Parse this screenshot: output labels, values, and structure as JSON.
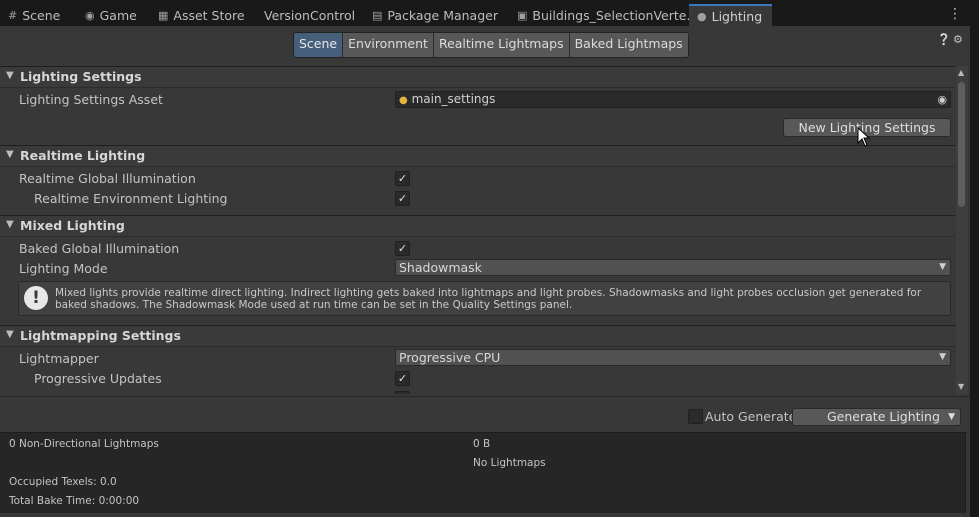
{
  "tabs": [
    {
      "label": "Scene",
      "icon": "grid-icon"
    },
    {
      "label": "Game",
      "icon": "gamepad-icon"
    },
    {
      "label": "Asset Store",
      "icon": "store-icon"
    },
    {
      "label": "VersionControl",
      "icon": ""
    },
    {
      "label": "Package Manager",
      "icon": "package-icon"
    },
    {
      "label": "Buildings_SelectionVerte...",
      "icon": "shader-icon"
    },
    {
      "label": "Lighting",
      "icon": "bulb-icon"
    }
  ],
  "subtabs": [
    "Scene",
    "Environment",
    "Realtime Lightmaps",
    "Baked Lightmaps"
  ],
  "lighting_settings": {
    "header": "Lighting Settings",
    "asset_label": "Lighting Settings Asset",
    "asset_value": "main_settings",
    "new_button": "New Lighting Settings"
  },
  "realtime_lighting": {
    "header": "Realtime Lighting",
    "gi_label": "Realtime Global Illumination",
    "gi_checked": true,
    "env_label": "Realtime Environment Lighting",
    "env_checked": true
  },
  "mixed_lighting": {
    "header": "Mixed Lighting",
    "baked_gi_label": "Baked Global Illumination",
    "baked_gi_checked": true,
    "mode_label": "Lighting Mode",
    "mode_value": "Shadowmask",
    "help_text": "Mixed lights provide realtime direct lighting. Indirect lighting gets baked into lightmaps and light probes. Shadowmasks and light probes occlusion get generated for baked shadows. The Shadowmask Mode used at run time can be set in the Quality Settings panel."
  },
  "lightmapping": {
    "header": "Lightmapping Settings",
    "lightmapper_label": "Lightmapper",
    "lightmapper_value": "Progressive CPU",
    "progressive_label": "Progressive Updates",
    "progressive_checked": true
  },
  "footer": {
    "auto_generate_label": "Auto Generate",
    "auto_generate_checked": false,
    "generate_button": "Generate Lighting"
  },
  "stats": {
    "lightmaps": "0 Non-Directional Lightmaps",
    "size": "0 B",
    "no_lightmaps": "No Lightmaps",
    "texels": "Occupied Texels: 0.0",
    "bake_time": "Total Bake Time: 0:00:00"
  },
  "colors": {
    "accent": "#3a79bb",
    "selected_subtab": "#46607c"
  }
}
